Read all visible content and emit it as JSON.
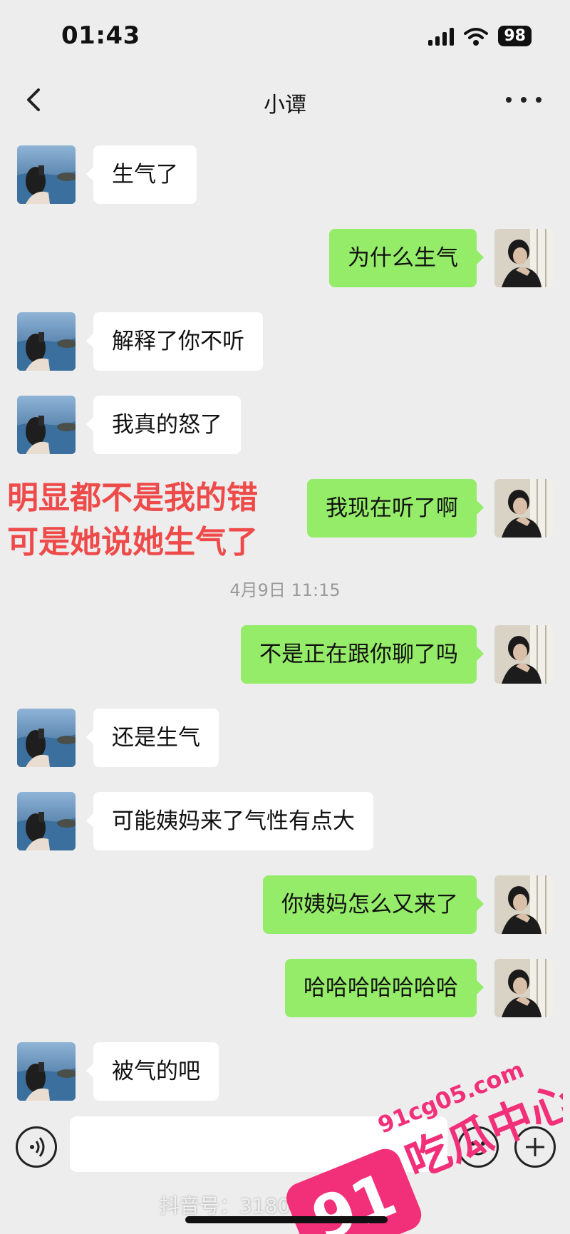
{
  "status_bar": {
    "time": "01:43",
    "battery": "98"
  },
  "nav": {
    "title": "小谭"
  },
  "messages": [
    {
      "side": "incoming",
      "text": "生气了"
    },
    {
      "side": "outgoing",
      "text": "为什么生气"
    },
    {
      "side": "incoming",
      "text": "解释了你不听"
    },
    {
      "side": "incoming",
      "text": "我真的怒了"
    },
    {
      "side": "outgoing",
      "text": "我现在听了啊"
    },
    {
      "side": "outgoing",
      "text": "不是正在跟你聊了吗"
    },
    {
      "side": "incoming",
      "text": "还是生气"
    },
    {
      "side": "incoming",
      "text": "可能姨妈来了气性有点大"
    },
    {
      "side": "outgoing",
      "text": "你姨妈怎么又来了"
    },
    {
      "side": "outgoing",
      "text": "哈哈哈哈哈哈哈"
    },
    {
      "side": "incoming",
      "text": "被气的吧"
    }
  ],
  "timestamp": "4月9日 11:15",
  "overlay_caption": {
    "line1": "明显都不是我的错",
    "line2": "可是她说她生气了"
  },
  "watermark": {
    "douyin": "抖音号：31807 8787",
    "site": "91cg05.com",
    "brand_number": "91",
    "brand_name": "吃瓜中心"
  },
  "colors": {
    "incoming_bubble": "#ffffff",
    "outgoing_bubble": "#95ec69",
    "background": "#ededed",
    "caption": "#ee4a4a",
    "logo": "#f2307a"
  }
}
